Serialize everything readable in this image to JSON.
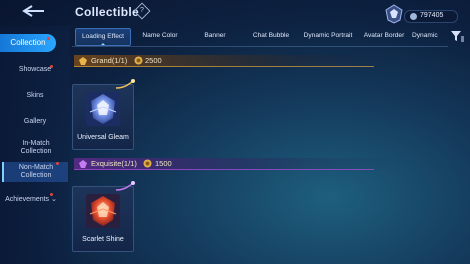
{
  "header": {
    "title": "Collectible",
    "help_glyph": "?",
    "currency_amount": "797405"
  },
  "sidebar": {
    "items": [
      {
        "label": "Collection",
        "active": true,
        "badge": true
      },
      {
        "label": "Showcase",
        "badge": true
      },
      {
        "label": "Skins"
      },
      {
        "label": "Gallery"
      },
      {
        "label": "In-Match Collection"
      },
      {
        "label": "Non-Match Collection",
        "selected": true,
        "badge": true
      },
      {
        "label": "Achievements",
        "badge": true
      }
    ]
  },
  "tabs": [
    {
      "label": "Loading Effect",
      "active": true
    },
    {
      "label": "Name Color"
    },
    {
      "label": "Banner"
    },
    {
      "label": "Chat Bubble"
    },
    {
      "label": "Dynamic Portrait"
    },
    {
      "label": "Avatar Border"
    },
    {
      "label": "Dynamic"
    }
  ],
  "sections": [
    {
      "label": "Grand(1/1)",
      "points": "2500",
      "accent": "#d9a23f",
      "items": [
        {
          "name": "Universal Gleam"
        }
      ]
    },
    {
      "label": "Exquisite(1/1)",
      "points": "1500",
      "accent": "#b14fe0",
      "items": [
        {
          "name": "Scarlet Shine"
        }
      ]
    }
  ],
  "colors": {
    "active_tab_accent": "#29a6ff",
    "badge": "#e0433c"
  }
}
